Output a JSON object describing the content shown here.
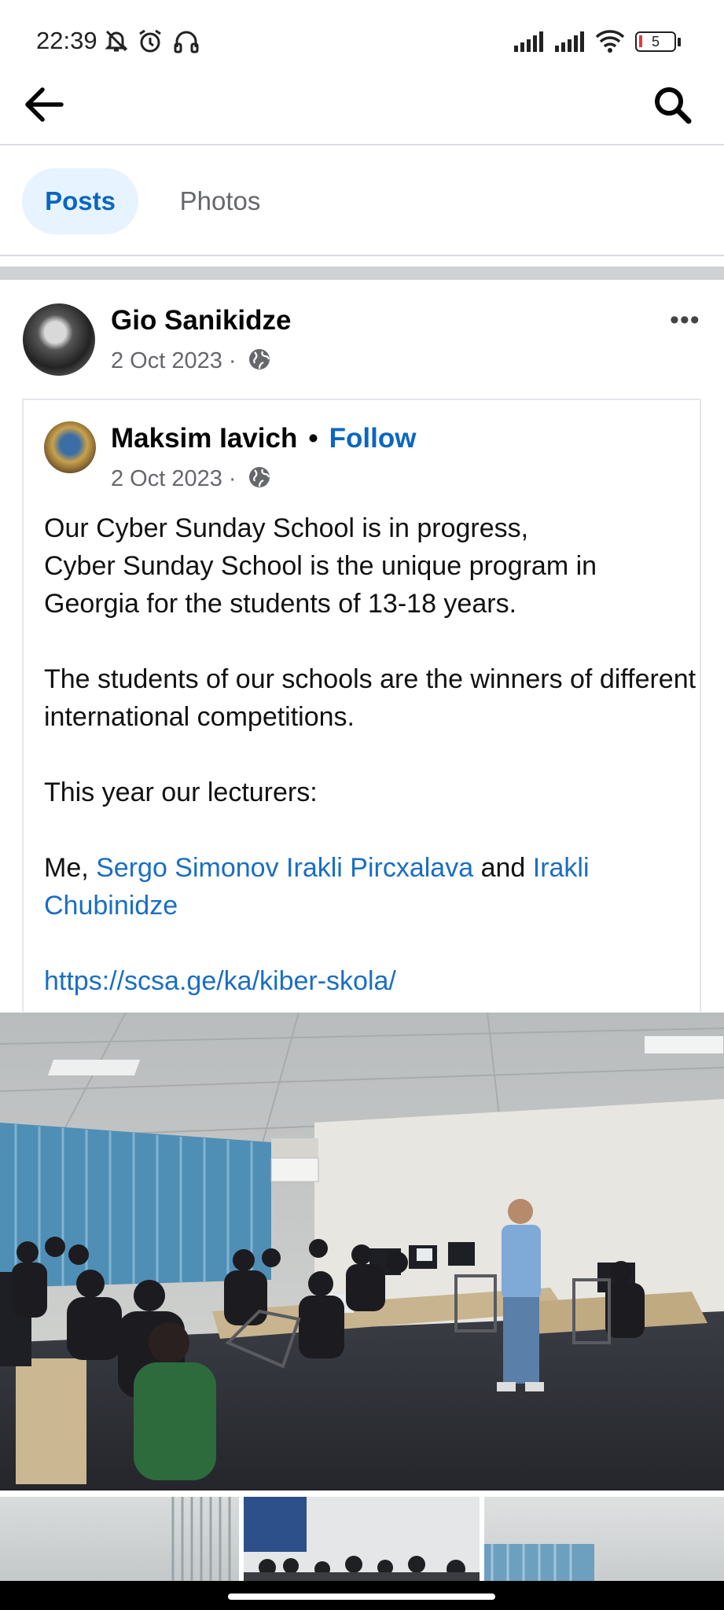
{
  "status_bar": {
    "time": "22:39",
    "icons": [
      "bell-off-icon",
      "alarm-icon",
      "headphones-icon",
      "signal-icon",
      "signal-icon",
      "wifi-icon",
      "battery-icon"
    ],
    "battery_level": "5"
  },
  "top_bar": {
    "back_icon": "arrow-left-icon",
    "search_icon": "search-icon"
  },
  "tabs": [
    {
      "label": "Posts",
      "selected": true
    },
    {
      "label": "Photos",
      "selected": false
    }
  ],
  "post": {
    "author": "Gio Sanikidze",
    "date": "2 Oct 2023 ·",
    "privacy_icon": "globe-icon",
    "more_label": "•••",
    "shared": {
      "author": "Maksim Iavich",
      "dot": "•",
      "follow_label": "Follow",
      "date": "2 Oct 2023 ·",
      "lines": {
        "l1": "Our Cyber Sunday School is in progress,",
        "l2": "Cyber Sunday School is the unique program in Georgia for the students of 13-18 years.",
        "l3": "The students of our schools are the winners of different international competitions.",
        "l4": "This year our lecturers:",
        "l5_prefix": "Me, ",
        "l5_link1": "Sergo  Simonov",
        "l5_space": " ",
        "l5_link2": "Irakli Pircxalava",
        "l5_and": " and ",
        "l5_link3": "Irakli Chubinidze",
        "url": "https://scsa.ge/ka/kiber-skola/"
      }
    }
  },
  "colors": {
    "accent": "#0a66c2",
    "tab_selected_bg": "#e7f3ff",
    "secondary_text": "#65676b",
    "link": "#1a6ec4"
  }
}
